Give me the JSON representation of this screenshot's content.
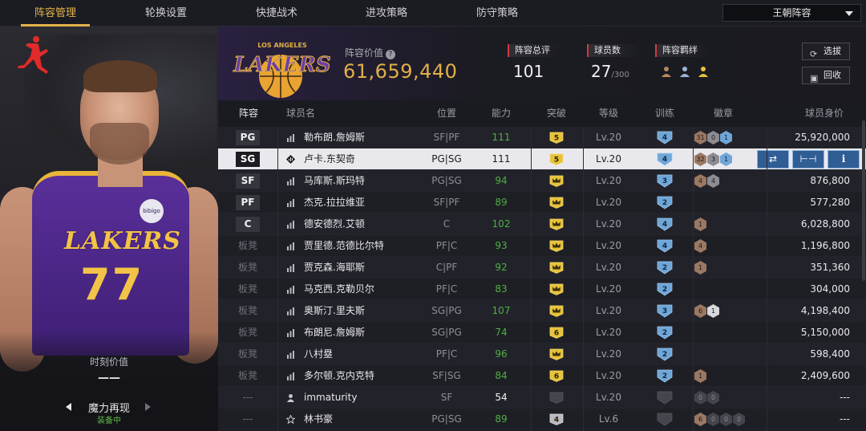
{
  "nav": {
    "tabs": [
      {
        "label": "阵容管理",
        "active": true
      },
      {
        "label": "轮换设置",
        "active": false
      },
      {
        "label": "快捷战术",
        "active": false
      },
      {
        "label": "进攻策略",
        "active": false
      },
      {
        "label": "防守策略",
        "active": false
      }
    ],
    "dropdown": "王朝阵容"
  },
  "left": {
    "jersey_word": "LAKERS",
    "jersey_number": "77",
    "sponsor": "bibigo",
    "moment_label": "时刻价值",
    "moment_value": "——",
    "skill_name": "魔力再现",
    "skill_status": "装备中"
  },
  "summary": {
    "team_logo_text": "LAKERS",
    "team_logo_arc": "LOS ANGELES",
    "value_label": "阵容价值",
    "value": "61,659,440",
    "overall_label": "阵容总评",
    "overall": "101",
    "players_label": "球员数",
    "players": "27",
    "players_max": "/300",
    "chem_label": "阵容羁绊",
    "btn_select": "选拔",
    "btn_recycle": "回收"
  },
  "colors": {
    "accent": "#e4b24a",
    "ability_green": "#4fae45",
    "train_blue": "#6fa6d8",
    "action_blue": "#2f5d94"
  },
  "table": {
    "headers": {
      "lineup": "阵容",
      "name": "球员名",
      "position": "位置",
      "ability": "能力",
      "breakthrough": "突破",
      "level": "等级",
      "training": "训练",
      "badge": "徽章",
      "salary": "球员身价"
    },
    "rows": [
      {
        "slot": "PG",
        "name": "勒布朗.詹姆斯",
        "pos": "SF|PF",
        "ability": "111",
        "ab_color": "green",
        "brk": "5",
        "level": "Lv.20",
        "train": "4",
        "badges": [
          [
            "31",
            "bronze"
          ],
          [
            "0",
            "grey"
          ],
          [
            "1",
            "blue"
          ]
        ],
        "salary": "25,920,000",
        "tier": "bars"
      },
      {
        "slot": "SG",
        "name": "卢卡.东契奇",
        "pos": "PG|SG",
        "ability": "111",
        "ab_color": "white",
        "brk": "5",
        "level": "Lv.20",
        "train": "4",
        "badges": [
          [
            "32",
            "bronze"
          ],
          [
            "3",
            "grey"
          ],
          [
            "1",
            "blue"
          ]
        ],
        "salary": "",
        "tier": "diamond",
        "selected": true
      },
      {
        "slot": "SF",
        "name": "马库斯.斯玛特",
        "pos": "PG|SG",
        "ability": "94",
        "ab_color": "green",
        "brk": "crown",
        "level": "Lv.20",
        "train": "3",
        "badges": [
          [
            "4",
            "bronze"
          ],
          [
            "4",
            "grey"
          ]
        ],
        "salary": "876,800",
        "tier": "bars"
      },
      {
        "slot": "PF",
        "name": "杰克.拉拉维亚",
        "pos": "SF|PF",
        "ability": "89",
        "ab_color": "green",
        "brk": "crown",
        "level": "Lv.20",
        "train": "2",
        "badges": [],
        "salary": "577,280",
        "tier": "bars"
      },
      {
        "slot": "C",
        "name": "德安德烈.艾顿",
        "pos": "C",
        "ability": "102",
        "ab_color": "green",
        "brk": "crown",
        "level": "Lv.20",
        "train": "4",
        "badges": [
          [
            "1",
            "bronze"
          ]
        ],
        "salary": "6,028,800",
        "tier": "bars"
      },
      {
        "slot": "板凳",
        "name": "贾里德.范德比尔特",
        "pos": "PF|C",
        "ability": "93",
        "ab_color": "green",
        "brk": "crown",
        "level": "Lv.20",
        "train": "4",
        "badges": [
          [
            "4",
            "bronze"
          ]
        ],
        "salary": "1,196,800",
        "tier": "bars"
      },
      {
        "slot": "板凳",
        "name": "贾克森.海耶斯",
        "pos": "C|PF",
        "ability": "92",
        "ab_color": "green",
        "brk": "crown",
        "level": "Lv.20",
        "train": "2",
        "badges": [
          [
            "1",
            "bronze"
          ]
        ],
        "salary": "351,360",
        "tier": "bars"
      },
      {
        "slot": "板凳",
        "name": "马克西.克勒贝尔",
        "pos": "PF|C",
        "ability": "83",
        "ab_color": "green",
        "brk": "crown",
        "level": "Lv.20",
        "train": "2",
        "badges": [],
        "salary": "304,000",
        "tier": "bars"
      },
      {
        "slot": "板凳",
        "name": "奥斯汀.里夫斯",
        "pos": "SG|PG",
        "ability": "107",
        "ab_color": "green",
        "brk": "crown",
        "level": "Lv.20",
        "train": "3",
        "badges": [
          [
            "6",
            "bronze"
          ],
          [
            "1",
            "white"
          ]
        ],
        "salary": "4,198,400",
        "tier": "bars"
      },
      {
        "slot": "板凳",
        "name": "布朗尼.詹姆斯",
        "pos": "SG|PG",
        "ability": "74",
        "ab_color": "green",
        "brk": "6",
        "level": "Lv.20",
        "train": "2",
        "badges": [],
        "salary": "5,150,000",
        "tier": "bars"
      },
      {
        "slot": "板凳",
        "name": "八村塁",
        "pos": "PF|C",
        "ability": "96",
        "ab_color": "green",
        "brk": "crown",
        "level": "Lv.20",
        "train": "2",
        "badges": [],
        "salary": "598,400",
        "tier": "bars"
      },
      {
        "slot": "板凳",
        "name": "多尔顿.克内克特",
        "pos": "SF|SG",
        "ability": "84",
        "ab_color": "green",
        "brk": "6",
        "level": "Lv.20",
        "train": "2",
        "badges": [
          [
            "1",
            "bronze"
          ]
        ],
        "salary": "2,409,600",
        "tier": "bars"
      },
      {
        "slot": "---",
        "name": "immaturity",
        "pos": "SF",
        "ability": "54",
        "ab_color": "white",
        "brk": "grey",
        "level": "Lv.20",
        "train": "grey",
        "badges": [
          [
            "0",
            "dark"
          ],
          [
            "0",
            "dark"
          ]
        ],
        "salary": "---",
        "tier": "person"
      },
      {
        "slot": "---",
        "name": "林书豪",
        "pos": "PG|SG",
        "ability": "89",
        "ab_color": "green",
        "brk": "4",
        "level": "Lv.6",
        "train": "grey",
        "badges": [
          [
            "6",
            "bronze"
          ],
          [
            "0",
            "dark"
          ],
          [
            "0",
            "dark"
          ],
          [
            "0",
            "dark"
          ]
        ],
        "salary": "---",
        "tier": "star"
      }
    ]
  }
}
